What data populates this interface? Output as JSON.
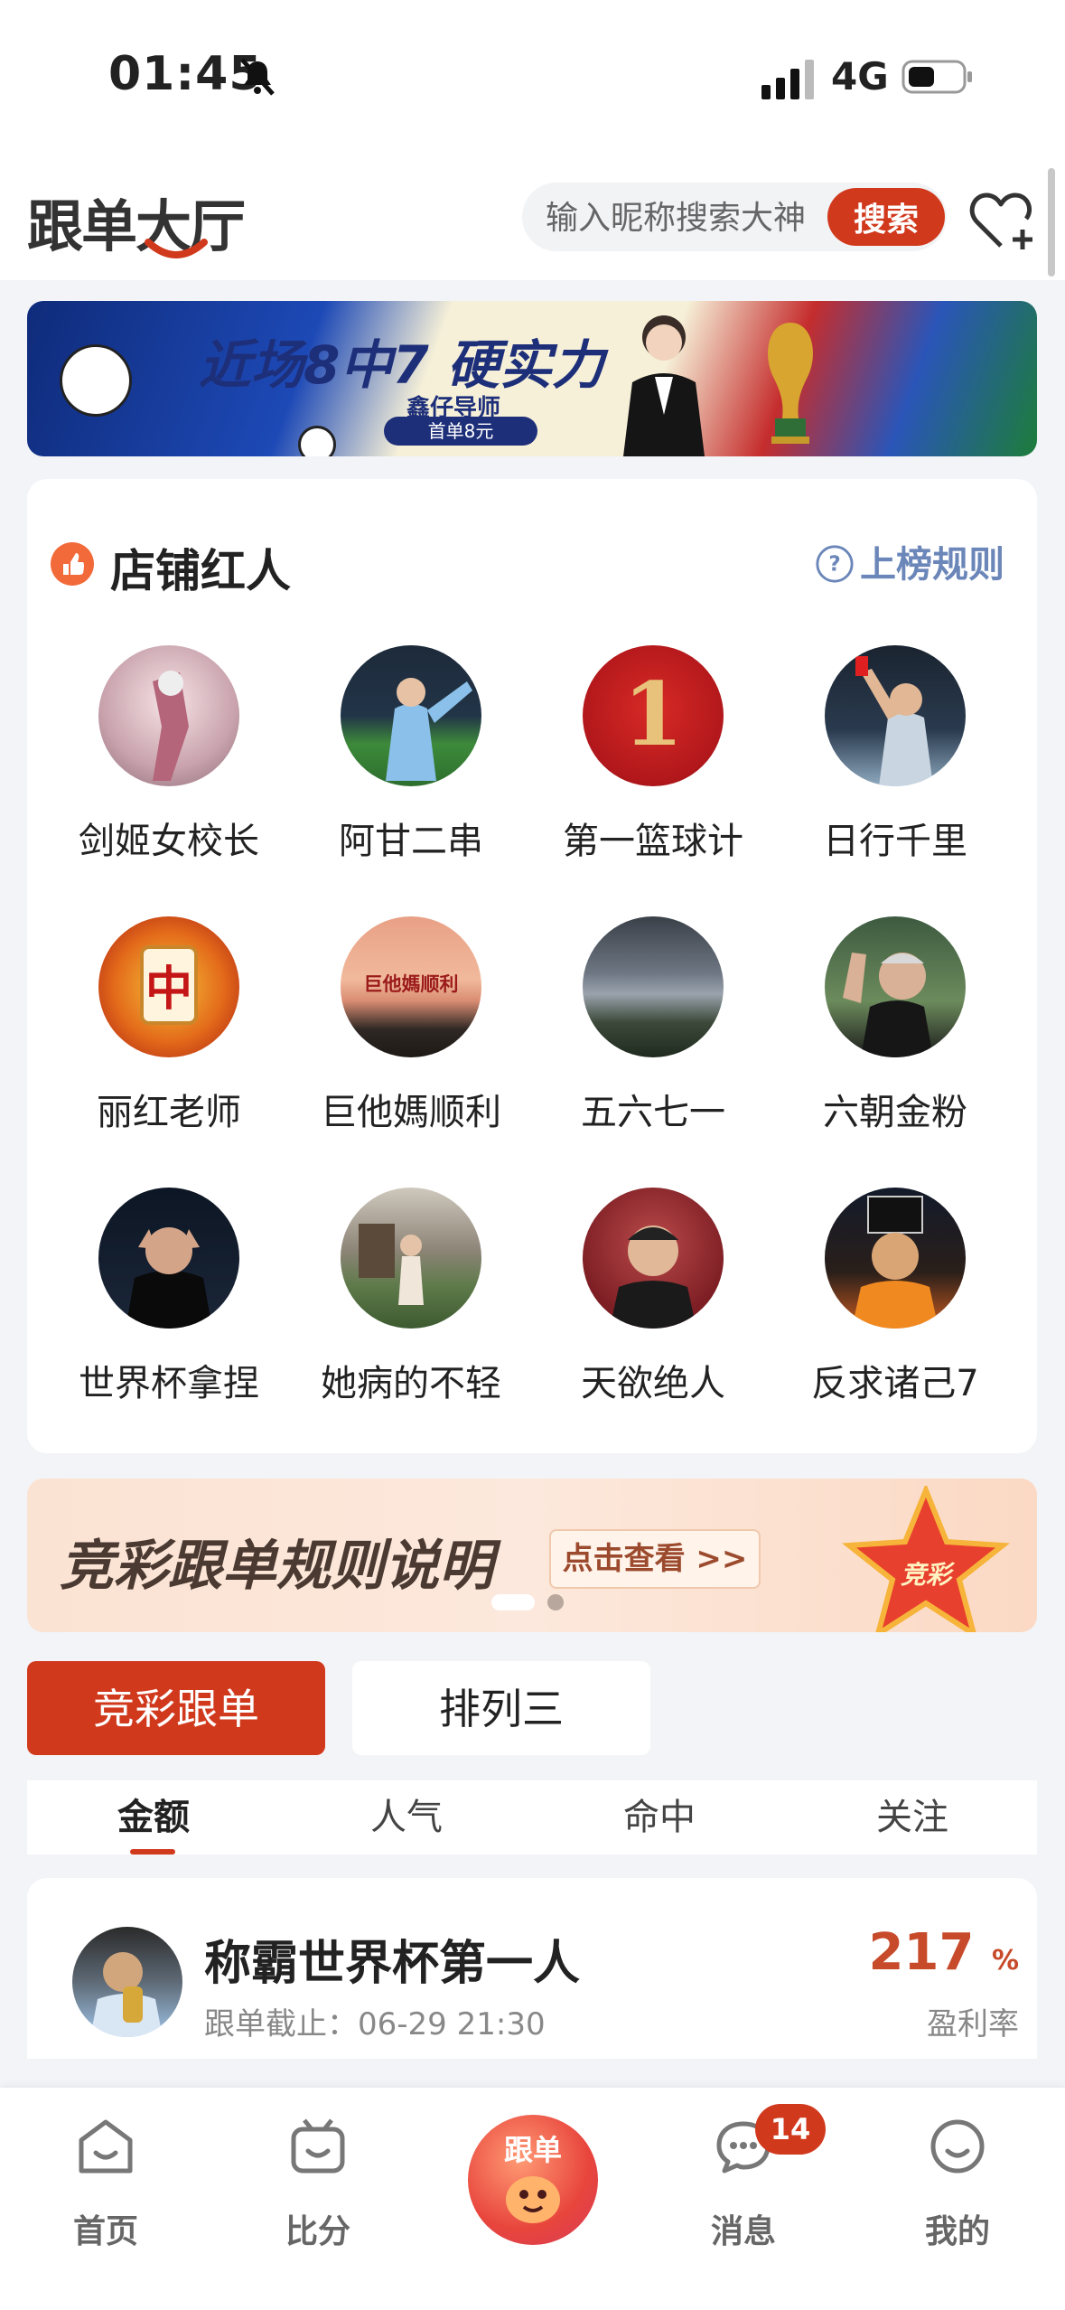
{
  "status": {
    "time": "01:45",
    "network": "4G"
  },
  "header": {
    "logo": "跟单大厅",
    "search_placeholder": "输入昵称搜索大神",
    "search_button": "搜索"
  },
  "banner": {
    "title": "近场8中7 硬实力",
    "subtitle": "鑫仔导师",
    "tag": "首单8元"
  },
  "influencers": {
    "title": "店铺红人",
    "rules_label": "上榜规则",
    "items": [
      {
        "name": "剑姬女校长"
      },
      {
        "name": "阿甘二串"
      },
      {
        "name": "第一篮球计"
      },
      {
        "name": "日行千里"
      },
      {
        "name": "丽红老师"
      },
      {
        "name": "巨他媽顺利"
      },
      {
        "name": "五六七一"
      },
      {
        "name": "六朝金粉"
      },
      {
        "name": "世界杯拿捏"
      },
      {
        "name": "她病的不轻"
      },
      {
        "name": "天欲绝人"
      },
      {
        "name": "反求诸己7"
      }
    ],
    "avatar_text": {
      "mahjong": "中",
      "sky": "巨他媽顺利",
      "number": "1"
    }
  },
  "promo": {
    "title": "竞彩跟单规则说明",
    "button": "点击查看 >>",
    "badge": "竞彩"
  },
  "tabs": {
    "active": "竞彩跟单",
    "inactive": "排列三"
  },
  "sort": {
    "options": [
      "金额",
      "人气",
      "命中",
      "关注"
    ]
  },
  "list": {
    "items": [
      {
        "name": "称霸世界杯第一人",
        "deadline": "跟单截止：06-29 21:30",
        "profit": "217",
        "profit_unit": "%",
        "profit_label": "盈利率"
      }
    ]
  },
  "nav": {
    "items": [
      "首页",
      "比分",
      "跟单",
      "消息",
      "我的"
    ],
    "message_badge": "14"
  },
  "colors": {
    "accent": "#d1391d",
    "link": "#6b86b8",
    "background": "#f3f4f7"
  }
}
